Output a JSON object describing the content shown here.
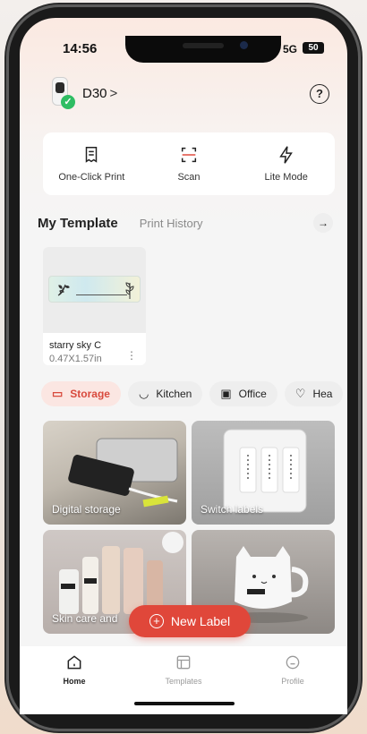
{
  "status": {
    "time": "14:56",
    "network": "5G",
    "battery": "50"
  },
  "device": {
    "name": "D30",
    "chevron": ">"
  },
  "quick_actions": [
    {
      "label": "One-Click Print",
      "icon": "print-doc-icon"
    },
    {
      "label": "Scan",
      "icon": "scan-icon"
    },
    {
      "label": "Lite Mode",
      "icon": "lightning-icon"
    }
  ],
  "section_tabs": {
    "active": "My Template",
    "inactive": "Print History"
  },
  "template": {
    "name": "starry sky C",
    "size": "0.47X1.57in",
    "more": "⋮"
  },
  "categories": [
    {
      "label": "Storage",
      "icon": "storage-box-icon",
      "selected": true
    },
    {
      "label": "Kitchen",
      "icon": "pot-icon",
      "selected": false
    },
    {
      "label": "Office",
      "icon": "terminal-icon",
      "selected": false
    },
    {
      "label": "Hea",
      "icon": "health-icon",
      "selected": false
    }
  ],
  "grid": [
    {
      "label": "Digital storage"
    },
    {
      "label": "Switch labels"
    },
    {
      "label": "Skin care and"
    },
    {
      "label": ""
    }
  ],
  "fab": {
    "label": "New Label"
  },
  "nav": [
    {
      "label": "Home",
      "icon": "home-icon",
      "active": true
    },
    {
      "label": "Templates",
      "icon": "templates-icon",
      "active": false
    },
    {
      "label": "Profile",
      "icon": "profile-icon",
      "active": false
    }
  ],
  "colors": {
    "accent": "#e0473a",
    "chip_selected_bg": "#fbe6e2",
    "online": "#2ebd63"
  }
}
